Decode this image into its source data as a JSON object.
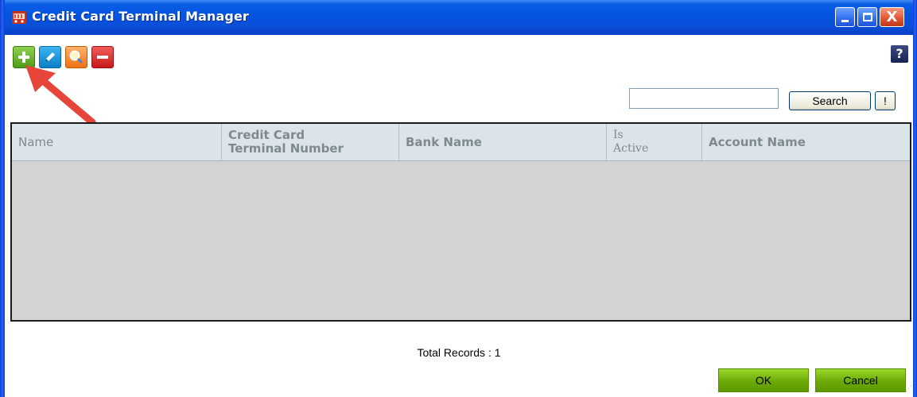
{
  "window": {
    "title": "Credit Card Terminal Manager",
    "icon": "shopping-cart-icon",
    "controls": [
      "minimize",
      "maximize",
      "close"
    ],
    "close_glyph": "X"
  },
  "toolbar": {
    "tools": [
      {
        "name": "add",
        "icon": "plus-icon",
        "color": "#5aa820"
      },
      {
        "name": "edit",
        "icon": "pencil-icon",
        "color": "#0a8fd8"
      },
      {
        "name": "find",
        "icon": "magnifier-icon",
        "color": "#f07a1a"
      },
      {
        "name": "delete",
        "icon": "minus-icon",
        "color": "#d42020"
      }
    ],
    "help_label": "?"
  },
  "search": {
    "value": "",
    "button_label": "Search",
    "clear_label": "!"
  },
  "grid": {
    "columns": [
      "Name",
      "Credit Card\nTerminal Number",
      "Bank Name",
      "Is\nActive",
      "Account Name"
    ],
    "rows": []
  },
  "footer": {
    "total_records": "Total Records : 1",
    "ok_label": "OK",
    "cancel_label": "Cancel"
  },
  "annotation": {
    "arrow_color": "#e8453a",
    "points_to": "add"
  }
}
